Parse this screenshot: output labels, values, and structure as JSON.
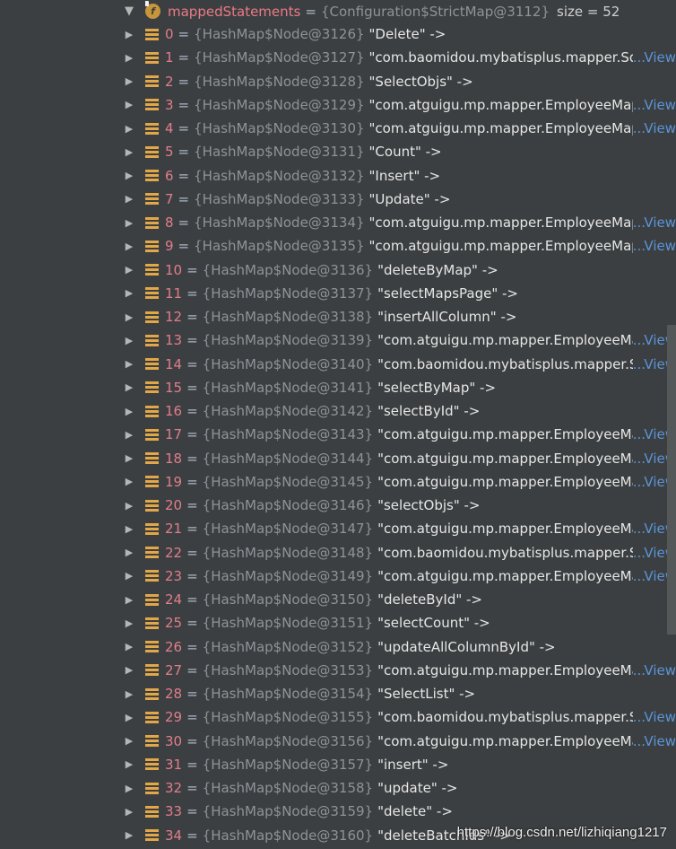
{
  "header": {
    "name": "mappedStatements",
    "type": "{Configuration$StrictMap@3112}",
    "size": "size = 52"
  },
  "view_label": "View",
  "watermark": "https://blog.csdn.net/lizhiqiang1217",
  "rows": [
    {
      "index": "0",
      "type": "{HashMap$Node@3126}",
      "value": "\"Delete\" ->",
      "truncated": false
    },
    {
      "index": "1",
      "type": "{HashMap$Node@3127}",
      "value": "\"com.baomidou.mybatisplus.mapper.SqlR",
      "truncated": true
    },
    {
      "index": "2",
      "type": "{HashMap$Node@3128}",
      "value": "\"SelectObjs\" ->",
      "truncated": false
    },
    {
      "index": "3",
      "type": "{HashMap$Node@3129}",
      "value": "\"com.atguigu.mp.mapper.EmployeeMapp",
      "truncated": true
    },
    {
      "index": "4",
      "type": "{HashMap$Node@3130}",
      "value": "\"com.atguigu.mp.mapper.EmployeeMapp",
      "truncated": true
    },
    {
      "index": "5",
      "type": "{HashMap$Node@3131}",
      "value": "\"Count\" ->",
      "truncated": false
    },
    {
      "index": "6",
      "type": "{HashMap$Node@3132}",
      "value": "\"Insert\" ->",
      "truncated": false
    },
    {
      "index": "7",
      "type": "{HashMap$Node@3133}",
      "value": "\"Update\" ->",
      "truncated": false
    },
    {
      "index": "8",
      "type": "{HashMap$Node@3134}",
      "value": "\"com.atguigu.mp.mapper.EmployeeMapp",
      "truncated": true
    },
    {
      "index": "9",
      "type": "{HashMap$Node@3135}",
      "value": "\"com.atguigu.mp.mapper.EmployeeMapp",
      "truncated": true
    },
    {
      "index": "10",
      "type": "{HashMap$Node@3136}",
      "value": "\"deleteByMap\" ->",
      "truncated": false
    },
    {
      "index": "11",
      "type": "{HashMap$Node@3137}",
      "value": "\"selectMapsPage\" ->",
      "truncated": false
    },
    {
      "index": "12",
      "type": "{HashMap$Node@3138}",
      "value": "\"insertAllColumn\" ->",
      "truncated": false
    },
    {
      "index": "13",
      "type": "{HashMap$Node@3139}",
      "value": "\"com.atguigu.mp.mapper.EmployeeMap",
      "truncated": true
    },
    {
      "index": "14",
      "type": "{HashMap$Node@3140}",
      "value": "\"com.baomidou.mybatisplus.mapper.Sql",
      "truncated": true
    },
    {
      "index": "15",
      "type": "{HashMap$Node@3141}",
      "value": "\"selectByMap\" ->",
      "truncated": false
    },
    {
      "index": "16",
      "type": "{HashMap$Node@3142}",
      "value": "\"selectById\" ->",
      "truncated": false
    },
    {
      "index": "17",
      "type": "{HashMap$Node@3143}",
      "value": "\"com.atguigu.mp.mapper.EmployeeMap",
      "truncated": true
    },
    {
      "index": "18",
      "type": "{HashMap$Node@3144}",
      "value": "\"com.atguigu.mp.mapper.EmployeeMap",
      "truncated": true
    },
    {
      "index": "19",
      "type": "{HashMap$Node@3145}",
      "value": "\"com.atguigu.mp.mapper.EmployeeMap",
      "truncated": true
    },
    {
      "index": "20",
      "type": "{HashMap$Node@3146}",
      "value": "\"selectObjs\" ->",
      "truncated": false
    },
    {
      "index": "21",
      "type": "{HashMap$Node@3147}",
      "value": "\"com.atguigu.mp.mapper.EmployeeMap",
      "truncated": true
    },
    {
      "index": "22",
      "type": "{HashMap$Node@3148}",
      "value": "\"com.baomidou.mybatisplus.mapper.Sql",
      "truncated": true
    },
    {
      "index": "23",
      "type": "{HashMap$Node@3149}",
      "value": "\"com.atguigu.mp.mapper.EmployeeMap",
      "truncated": true
    },
    {
      "index": "24",
      "type": "{HashMap$Node@3150}",
      "value": "\"deleteById\" ->",
      "truncated": false
    },
    {
      "index": "25",
      "type": "{HashMap$Node@3151}",
      "value": "\"selectCount\" ->",
      "truncated": false
    },
    {
      "index": "26",
      "type": "{HashMap$Node@3152}",
      "value": "\"updateAllColumnById\" ->",
      "truncated": false
    },
    {
      "index": "27",
      "type": "{HashMap$Node@3153}",
      "value": "\"com.atguigu.mp.mapper.EmployeeMap",
      "truncated": true
    },
    {
      "index": "28",
      "type": "{HashMap$Node@3154}",
      "value": "\"SelectList\" ->",
      "truncated": false
    },
    {
      "index": "29",
      "type": "{HashMap$Node@3155}",
      "value": "\"com.baomidou.mybatisplus.mapper.Sql",
      "truncated": true
    },
    {
      "index": "30",
      "type": "{HashMap$Node@3156}",
      "value": "\"com.atguigu.mp.mapper.EmployeeMap",
      "truncated": true
    },
    {
      "index": "31",
      "type": "{HashMap$Node@3157}",
      "value": "\"insert\" ->",
      "truncated": false
    },
    {
      "index": "32",
      "type": "{HashMap$Node@3158}",
      "value": "\"update\" ->",
      "truncated": false
    },
    {
      "index": "33",
      "type": "{HashMap$Node@3159}",
      "value": "\"delete\" ->",
      "truncated": false
    },
    {
      "index": "34",
      "type": "{HashMap$Node@3160}",
      "value": "\"deleteBatchIds\" ->",
      "truncated": false
    }
  ]
}
